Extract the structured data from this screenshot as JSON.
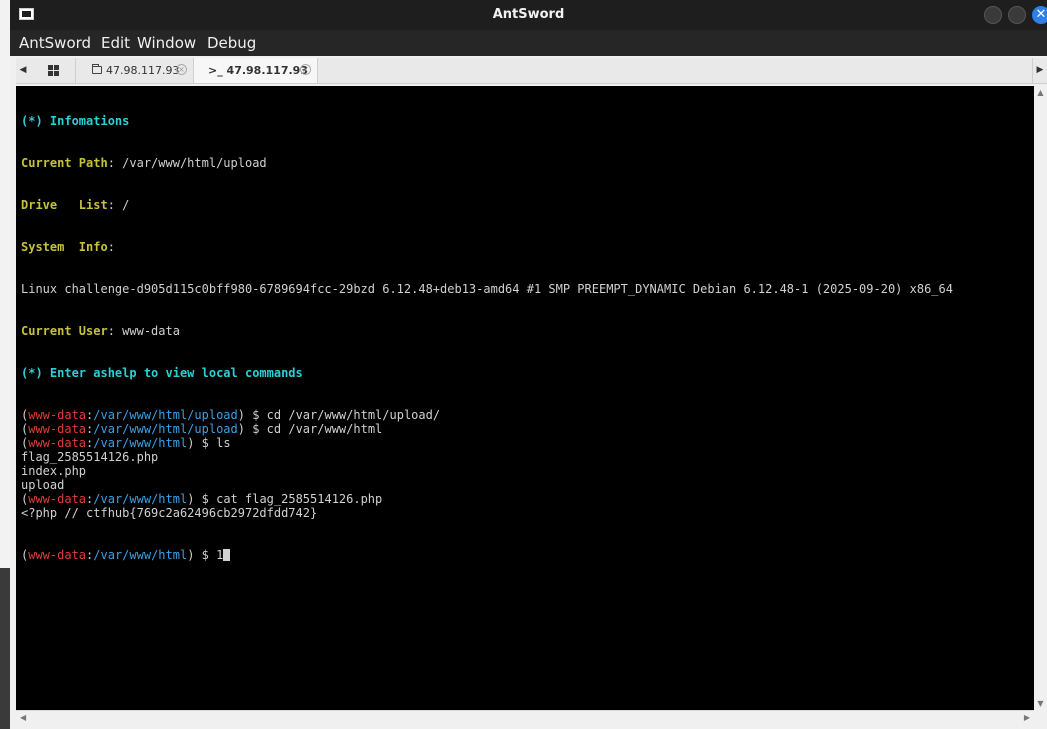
{
  "window": {
    "title": "AntSword",
    "close_glyph": "✕"
  },
  "menu": [
    "AntSword",
    "Edit",
    "Window",
    "Debug"
  ],
  "tabs": {
    "left_arrow": "◀",
    "right_arrow": "▶",
    "files_label": "47.98.117.93",
    "terminal_label": ">_ 47.98.117.93",
    "close_glyph": "×",
    "icons": [
      "grid-icon",
      "folder-icon",
      "terminal-icon"
    ]
  },
  "terminal": {
    "info_header": "(*) Infomations",
    "current_path_key": "Current Path",
    "current_path_val": "/var/www/html/upload",
    "drive_list_key": "Drive   List",
    "drive_list_val": "/",
    "system_info_key": "System  Info",
    "system_info_val": "Linux challenge-d905d115c0bff980-6789694fcc-29bzd 6.12.48+deb13-amd64 #1 SMP PREEMPT_DYNAMIC Debian 6.12.48-1 (2025-09-20) x86_64",
    "current_user_key": "Current User",
    "current_user_val": "www-data",
    "help_hint": "(*) Enter ashelp to view local commands",
    "prompt_user": "www-data",
    "commands": [
      {
        "path": "/var/www/html/upload",
        "cmd": "cd /var/www/html/upload/",
        "output": []
      },
      {
        "path": "/var/www/html/upload",
        "cmd": "cd /var/www/html",
        "output": []
      },
      {
        "path": "/var/www/html",
        "cmd": "ls",
        "output": [
          "flag_2585514126.php",
          "index.php",
          "upload"
        ]
      },
      {
        "path": "/var/www/html",
        "cmd": "cat flag_2585514126.php",
        "output": [
          "<?php // ctfhub{769c2a62496cb2972dfdd742}"
        ]
      }
    ],
    "current_prompt": {
      "path": "/var/www/html",
      "input": "1"
    }
  },
  "scrollbars": {
    "up": "▲",
    "down": "▼",
    "left": "◀",
    "right": "▶"
  },
  "colors": {
    "titlebar": "#1e1e1e",
    "close_button": "#2f7fe6",
    "terminal_bg": "#000000",
    "header_cyan": "#2ad0d7",
    "key_yellow": "#c6c23b",
    "prompt_user_red": "#e23a3a",
    "prompt_path_blue": "#3aa0e6"
  }
}
